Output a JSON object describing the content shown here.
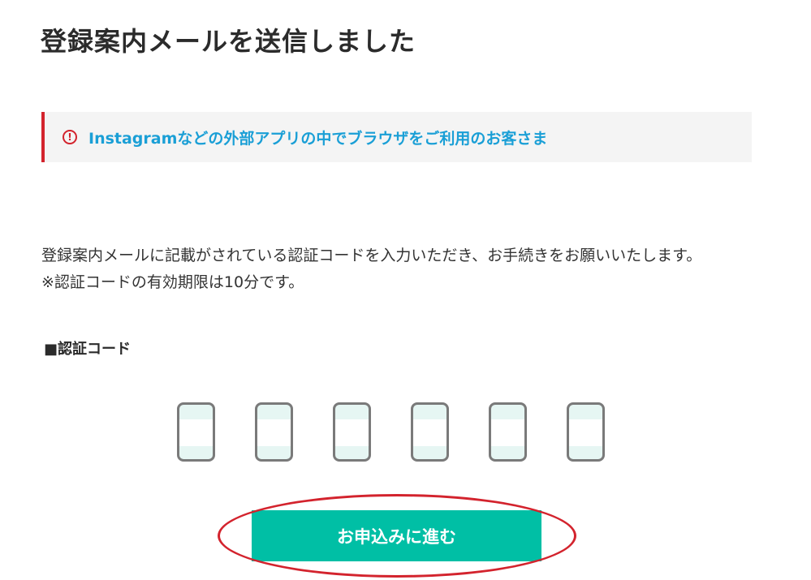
{
  "page": {
    "title": "登録案内メールを送信しました"
  },
  "notice": {
    "icon": "exclamation-circle-icon",
    "text": "Instagramなどの外部アプリの中でブラウザをご利用のお客さま",
    "accent_color": "#d3232d",
    "text_color": "#1a9fd6"
  },
  "description": {
    "line1": "登録案内メールに記載がされている認証コードを入力いただき、お手続きをお願いいたします。",
    "line2": "※認証コードの有効期限は10分です。"
  },
  "code": {
    "label": "■認証コード",
    "digits": [
      "",
      "",
      "",
      "",
      "",
      ""
    ]
  },
  "actions": {
    "proceed_label": "お申込みに進む",
    "button_color": "#00bfa5"
  },
  "annotation": {
    "highlight_color": "#d3232d"
  }
}
